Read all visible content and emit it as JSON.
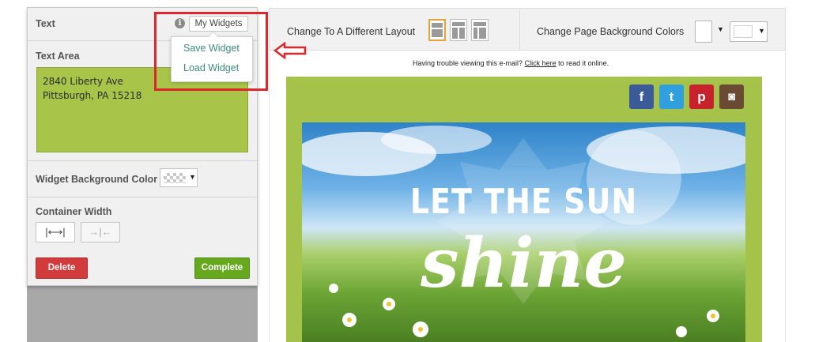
{
  "panel": {
    "text_section_title": "Text",
    "info_icon_glyph": "i",
    "my_widgets_label": "My Widgets",
    "dropdown": {
      "items": [
        "Save Widget",
        "Load Widget"
      ]
    },
    "text_area_title": "Text Area",
    "text_area_lines": [
      "2840 Liberty Ave",
      "Pittsburgh, PA 15218"
    ],
    "widget_bg_color_label": "Widget Background Color",
    "container_width_label": "Container Width",
    "width_full_glyph": "|⟷|",
    "width_fixed_glyph": "→|←",
    "caret_glyph": "▼",
    "delete_label": "Delete",
    "complete_label": "Complete"
  },
  "toolbar": {
    "layout_label": "Change To A Different Layout",
    "page_bg_label": "Change Page Background Colors",
    "caret_glyph": "▼"
  },
  "email": {
    "trouble_prefix": "Having trouble viewing this e-mail?",
    "trouble_link": "Click here",
    "trouble_suffix": "to read it online.",
    "social": [
      {
        "icon": "facebook-icon",
        "glyph": "f",
        "color": "#3b5a9a"
      },
      {
        "icon": "twitter-icon",
        "glyph": "t",
        "color": "#2f9fde"
      },
      {
        "icon": "pinterest-icon",
        "glyph": "p",
        "color": "#c8232c"
      },
      {
        "icon": "instagram-icon",
        "glyph": "◙",
        "color": "#6b4a34"
      }
    ],
    "hero_line1": "LET THE SUN",
    "hero_line2": "shine"
  },
  "colors": {
    "highlight": "#e0262d",
    "widget_green": "#a8c54a",
    "complete_green": "#66a81e",
    "delete_red": "#d23b3b",
    "link_teal": "#3d8c7a"
  }
}
